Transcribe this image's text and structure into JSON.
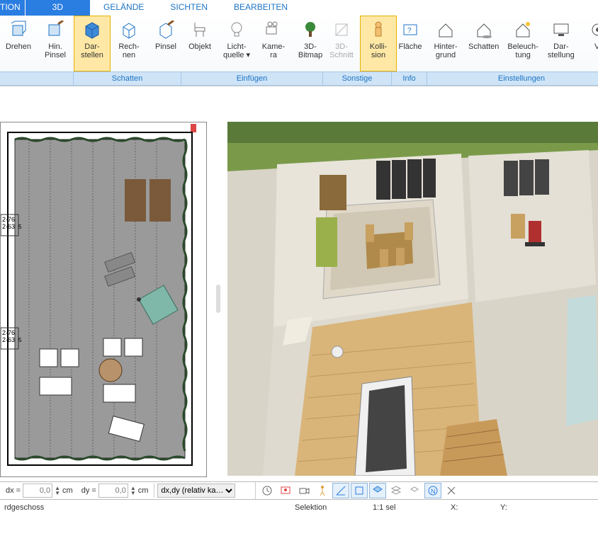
{
  "tabs": {
    "t0": "TION",
    "t1": "3D",
    "t2": "GELÄNDE",
    "t3": "SICHTEN",
    "t4": "BEARBEITEN"
  },
  "ribbon": {
    "drehen": "Drehen",
    "hin_pinsel": "Hin.\nPinsel",
    "darstellen": "Dar-\nstellen",
    "rechnen": "Rech-\nnen",
    "pinsel": "Pinsel",
    "objekt": "Objekt",
    "lichtquelle": "Licht-\nquelle ▾",
    "kamera": "Kame-\nra",
    "bitmap": "3D-\nBitmap",
    "schnitt": "3D-\nSchnitt",
    "kollision": "Kolli-\nsion",
    "flaeche": "Fläche",
    "hintergrund": "Hinter-\ngrund",
    "schatten2": "Schatten",
    "beleuchtung": "Beleuch-\ntung",
    "darstellung": "Dar-\nstellung",
    "vi": "Vi"
  },
  "groups": {
    "g1": "",
    "g2": "Schatten",
    "g3": "Einfügen",
    "g4": "Sonstige",
    "g5": "Info",
    "g6": "Einstellungen"
  },
  "footer": {
    "dx": "dx =",
    "dy": "dy =",
    "val": "0,0",
    "cm": "cm",
    "mode": "dx,dy (relativ ka…"
  },
  "status": {
    "floor": "rdgeschoss",
    "sel": "Selektion",
    "scale": "1:1 sel",
    "x": "X:",
    "y": "Y:"
  },
  "plan": {
    "d1": "2·76",
    "d2": "2·63",
    "d3": "5"
  }
}
